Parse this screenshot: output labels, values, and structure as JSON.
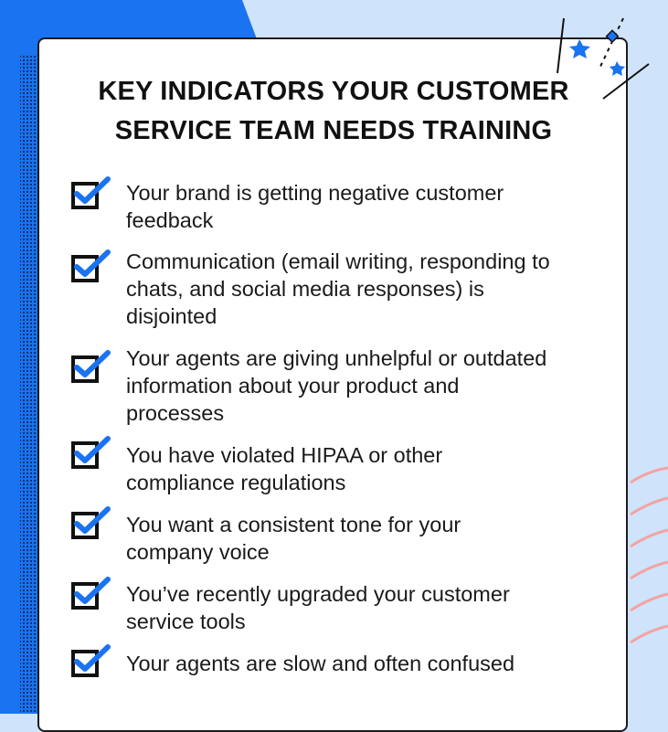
{
  "colors": {
    "background": "#cfe3fb",
    "accent_blue": "#1a73f0",
    "card": "#ffffff",
    "text": "#1a1a1a",
    "pink_lines": "#f3a3a3"
  },
  "title": {
    "line1": "KEY INDICATORS YOUR CUSTOMER",
    "line2": "SERVICE TEAM NEEDS TRAINING"
  },
  "items": [
    {
      "lines": [
        "Your brand is getting negative customer",
        "feedback"
      ]
    },
    {
      "lines": [
        "Communication (email writing, responding to",
        "chats, and social media responses) is",
        "disjointed"
      ]
    },
    {
      "lines": [
        "Your agents are giving unhelpful or outdated",
        "information about your product and",
        "processes"
      ]
    },
    {
      "lines": [
        "You have violated HIPAA or other",
        "compliance regulations"
      ]
    },
    {
      "lines": [
        "You want a consistent tone for your",
        "company voice"
      ]
    },
    {
      "lines": [
        "You’ve recently upgraded your customer",
        "service tools"
      ]
    },
    {
      "lines": [
        "Your agents are slow and often confused"
      ]
    }
  ],
  "icons": {
    "checkbox": "checked-checkbox-icon",
    "stars": "star-icon"
  }
}
